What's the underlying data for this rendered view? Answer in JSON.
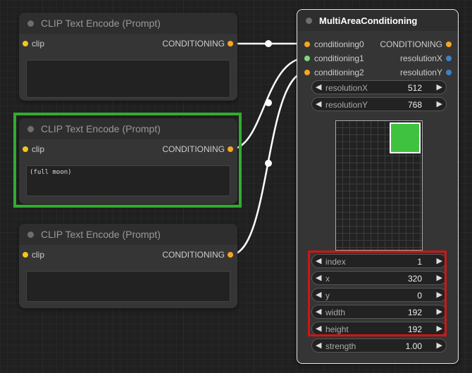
{
  "clip_nodes": [
    {
      "title": "CLIP Text Encode (Prompt)",
      "input_label": "clip",
      "output_label": "CONDITIONING",
      "text": ""
    },
    {
      "title": "CLIP Text Encode (Prompt)",
      "input_label": "clip",
      "output_label": "CONDITIONING",
      "text": "(full moon)"
    },
    {
      "title": "CLIP Text Encode (Prompt)",
      "input_label": "clip",
      "output_label": "CONDITIONING",
      "text": ""
    }
  ],
  "multi_area": {
    "title": "MultiAreaConditioning",
    "inputs": [
      "conditioning0",
      "conditioning1",
      "conditioning2"
    ],
    "outputs": [
      "CONDITIONING",
      "resolutionX",
      "resolutionY"
    ],
    "widgets": [
      {
        "name": "resolutionX",
        "value": "512"
      },
      {
        "name": "resolutionY",
        "value": "768"
      },
      {
        "name": "index",
        "value": "1"
      },
      {
        "name": "x",
        "value": "320"
      },
      {
        "name": "y",
        "value": "0"
      },
      {
        "name": "width",
        "value": "192"
      },
      {
        "name": "height",
        "value": "192"
      },
      {
        "name": "strength",
        "value": "1.00"
      }
    ]
  },
  "arrows": {
    "left": "◀",
    "right": "▶"
  },
  "colors": {
    "clip_slot": "#f5c518",
    "conditioning_slot": "#f5a623",
    "int_slot": "#3b82c4",
    "connected_slot": "#7fd67f",
    "wire": "#ffffff",
    "selected_outline": "#2fad2f",
    "area_fill": "#3fc23f",
    "highlight_red": "#d11515"
  }
}
